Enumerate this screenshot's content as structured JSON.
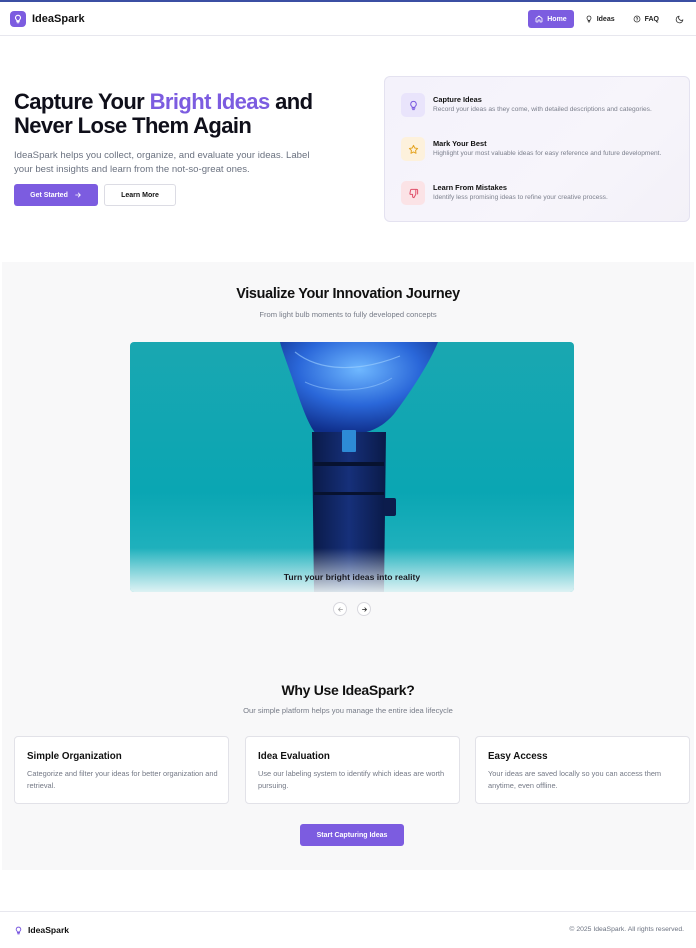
{
  "brand": {
    "name": "IdeaSpark",
    "accent_color": "#7c5ce0",
    "logo_icon": "lightbulb-icon"
  },
  "nav": {
    "items": [
      {
        "label": "Home",
        "icon": "home-icon",
        "active": true
      },
      {
        "label": "Ideas",
        "icon": "lightbulb-icon",
        "active": false
      },
      {
        "label": "FAQ",
        "icon": "help-circle-icon",
        "active": false
      }
    ],
    "theme_toggle_icon": "moon-icon"
  },
  "hero": {
    "title_part1": "Capture Your ",
    "title_accent": "Bright Ideas",
    "title_part2": " and Never Lose Them Again",
    "description": "IdeaSpark helps you collect, organize, and evaluate your ideas. Label your best insights and learn from the not-so-great ones.",
    "primary_button": "Get Started",
    "secondary_button": "Learn More"
  },
  "features": [
    {
      "title": "Capture Ideas",
      "text": "Record your ideas as they come, with detailed descriptions and categories.",
      "icon": "lightbulb-icon",
      "bg": "#e9e4fb",
      "color": "#7c5ce0"
    },
    {
      "title": "Mark Your Best",
      "text": "Highlight your most valuable ideas for easy reference and future development.",
      "icon": "star-icon",
      "bg": "#fdf1dc",
      "color": "#e5a524"
    },
    {
      "title": "Learn From Mistakes",
      "text": "Identify less promising ideas to refine your creative process.",
      "icon": "thumbs-down-icon",
      "bg": "#fbe3e6",
      "color": "#e0506a"
    }
  ],
  "gallery": {
    "title": "Visualize Your Innovation Journey",
    "subtitle": "From light bulb moments to fully developed concepts",
    "caption": "Turn your bright ideas into reality",
    "prev_icon": "arrow-left-icon",
    "next_icon": "arrow-right-icon"
  },
  "why": {
    "title": "Why Use IdeaSpark?",
    "subtitle": "Our simple platform helps you manage the entire idea lifecycle",
    "cards": [
      {
        "title": "Simple Organization",
        "text": "Categorize and filter your ideas for better organization and retrieval."
      },
      {
        "title": "Idea Evaluation",
        "text": "Use our labeling system to identify which ideas are worth pursuing."
      },
      {
        "title": "Easy Access",
        "text": "Your ideas are saved locally so you can access them anytime, even offline."
      }
    ],
    "cta_button": "Start Capturing Ideas"
  },
  "footer": {
    "brand": "IdeaSpark",
    "copyright": "© 2025 IdeaSpark. All rights reserved."
  }
}
